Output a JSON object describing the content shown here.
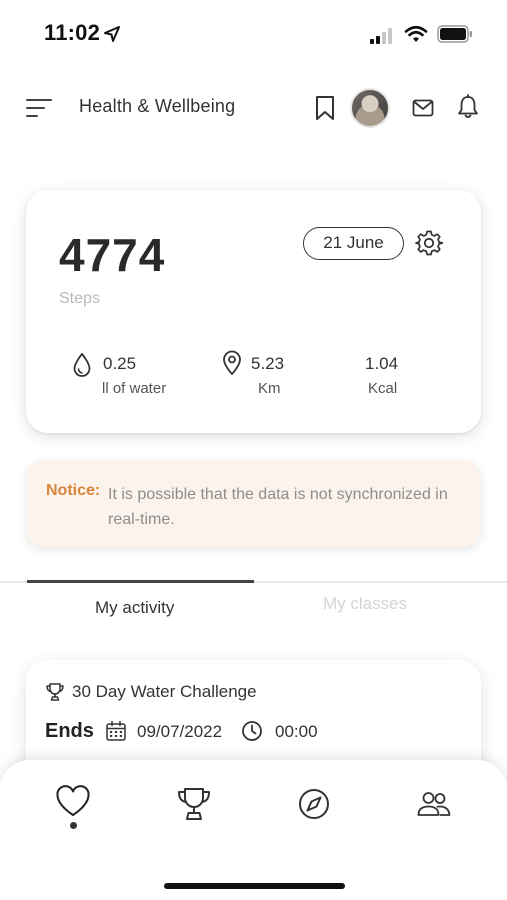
{
  "status_bar": {
    "time": "11:02"
  },
  "header": {
    "title": "Health & Wellbeing"
  },
  "steps_card": {
    "steps": "4774",
    "steps_label": "Steps",
    "date": "21 June",
    "stats": [
      {
        "icon": "water-drop-icon",
        "value": "0.25",
        "unit": "ll of water"
      },
      {
        "icon": "location-pin-icon",
        "value": "5.23",
        "unit": "Km"
      },
      {
        "icon": "",
        "value": "1.04",
        "unit": "Kcal"
      }
    ]
  },
  "notice": {
    "label": "Notice:",
    "text": "It is possible that the data is not synchronized in real-time."
  },
  "tabs": [
    {
      "label": "My activity",
      "active": true
    },
    {
      "label": "My classes",
      "active": false
    }
  ],
  "challenge": {
    "title": "30 Day Water Challenge",
    "ends_label": "Ends",
    "end_date": "09/07/2022",
    "end_time": "00:00"
  },
  "bottom_nav": {
    "items": [
      {
        "icon": "heart-icon",
        "active": true
      },
      {
        "icon": "trophy-icon",
        "active": false
      },
      {
        "icon": "compass-icon",
        "active": false
      },
      {
        "icon": "people-icon",
        "active": false
      }
    ]
  },
  "colors": {
    "notice_accent": "#d9853b",
    "notice_bg": "#fbf3ec",
    "muted_text": "#b9b9b9"
  }
}
